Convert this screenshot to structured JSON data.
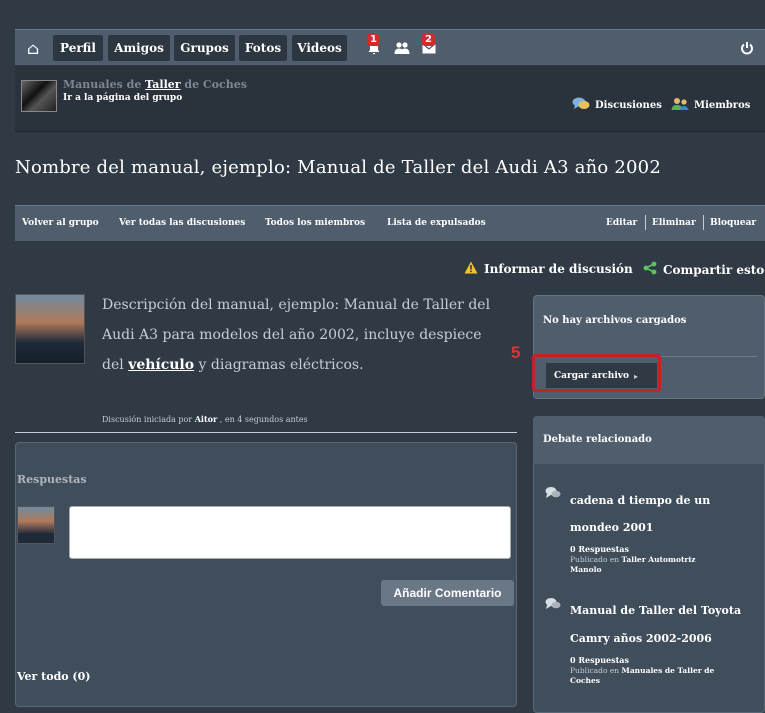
{
  "nav": {
    "home_icon": "home-icon",
    "tabs": [
      "Perfil",
      "Amigos",
      "Grupos",
      "Fotos",
      "Videos"
    ],
    "notifications_count": "1",
    "messages_count": "2",
    "power_icon": "power-icon"
  },
  "group": {
    "name_prefix": "Manuales de ",
    "name_highlight": "Taller",
    "name_suffix": " de Coches",
    "link": "Ir a la página del grupo",
    "discussions_label": "Discusiones",
    "members_label": "Miembros"
  },
  "page": {
    "title": "Nombre del manual, ejemplo: Manual de Taller del Audi A3 año 2002"
  },
  "subnav": {
    "back": "Volver al grupo",
    "all_discussions": "Ver todas las discusiones",
    "all_members": "Todos los miembros",
    "banned": "Lista de expulsados",
    "edit": "Editar",
    "delete": "Eliminar",
    "block": "Bloquear"
  },
  "actions": {
    "report": "Informar de discusión",
    "share": "Compartir esto"
  },
  "post": {
    "line1": "Descripción del manual, ejemplo: Manual de Taller del",
    "line2": "Audi A3 para modelos del año 2002, incluye despiece",
    "line3_pre": "del ",
    "line3_link": "vehículo",
    "line3_post": " y diagramas eléctricos.",
    "started_pre": "Discusión iniciada por ",
    "started_author": "Aitor",
    "started_post": " , en 4 segundos antes"
  },
  "replies": {
    "label": "Respuestas",
    "comment_value": "",
    "add_button": "Añadir Comentario",
    "view_all": "Ver todo (0)"
  },
  "files": {
    "none_label": "No hay archivos cargados",
    "upload_button": "Cargar archivo",
    "step_number": "5"
  },
  "related": {
    "title": "Debate relacionado",
    "items": [
      {
        "title_line1": "cadena d tiempo de un",
        "title_line2": "mondeo 2001",
        "replies": "0 Respuestas",
        "published_pre": "Publicado en ",
        "published_in_line1": "Taller Automotriz",
        "published_in_line2": "Manolo"
      },
      {
        "title_line1": "Manual de Taller del Toyota",
        "title_line2": "Camry años 2002-2006",
        "replies": "0 Respuestas",
        "published_pre": "Publicado en ",
        "published_in_line1": "Manuales de Taller de",
        "published_in_line2": "Coches"
      }
    ]
  },
  "colors": {
    "background": "#2f3a45",
    "nav_bar": "#4f5d6c",
    "highlight": "#c0242a",
    "badge": "#d42a2a"
  }
}
